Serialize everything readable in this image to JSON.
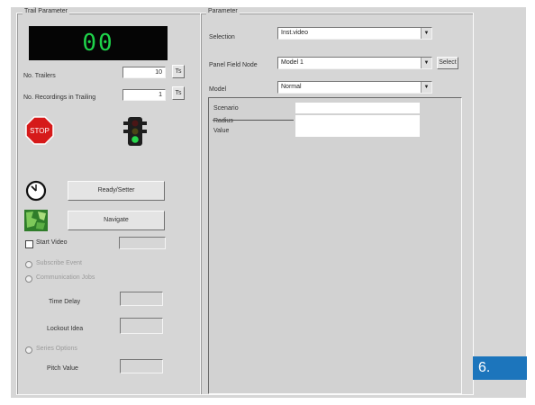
{
  "left_group": {
    "title": "Trail Parameter"
  },
  "display": {
    "value": "00"
  },
  "fields": [
    {
      "label": "No. Trailers",
      "value": "10",
      "button": "Ts"
    },
    {
      "label": "No. Recordings in Trailing",
      "value": "1",
      "button": "Ts"
    }
  ],
  "icons": {
    "stop": "stop-sign-icon",
    "go": "traffic-light-icon",
    "clock": "clock-icon",
    "map": "map-icon"
  },
  "buttons": {
    "ready": "Ready/Setter",
    "navigate": "Navigate"
  },
  "options": {
    "start_video": "Start Video",
    "radio_1": "Subscribe Event",
    "radio_2": "Communication Jobs",
    "time_delay_label": "Time Delay",
    "lockout_label": "Lockout Idea",
    "radio_3": "Series Options",
    "pulse_label": "Pitch Value"
  },
  "right_group": {
    "title": "Parameter",
    "selection_label": "Selection",
    "selection_value": "Inst.video",
    "panel_label": "Panel Field Node",
    "panel_value": "Model 1",
    "select_button": "Select",
    "model_label": "Model",
    "model_value": "Normal"
  },
  "grid": {
    "rows": [
      "Scenario",
      "Radius",
      "Value"
    ]
  },
  "badge": {
    "text": "6."
  },
  "colors": {
    "led_text": "#1ed34a",
    "badge": "#1c75bc",
    "window": "#d6d6d6"
  }
}
